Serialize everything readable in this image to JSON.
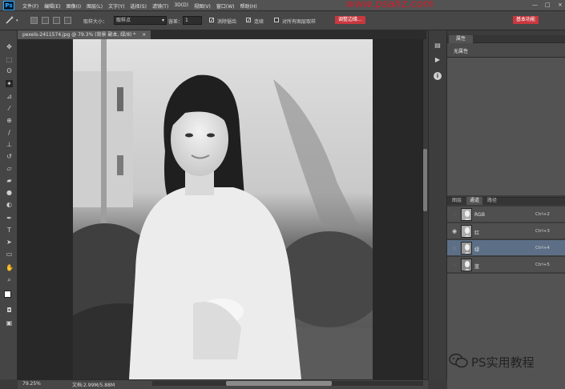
{
  "app": {
    "logo": "Ps"
  },
  "menu": [
    "文件(F)",
    "编辑(E)",
    "图像(I)",
    "图层(L)",
    "文字(Y)",
    "选择(S)",
    "滤镜(T)",
    "3D(D)",
    "视图(V)",
    "窗口(W)",
    "帮助(H)"
  ],
  "watermark": "www.psahz.com",
  "window_controls": [
    "—",
    "□",
    "×"
  ],
  "options": {
    "sample_size_label": "取样大小：",
    "sample_size_value": "取样点",
    "tolerance_label": "容差：",
    "tolerance_value": "1",
    "anti_alias_label": "消除锯齿",
    "anti_alias_checked": true,
    "contiguous_label": "连续",
    "contiguous_checked": true,
    "sample_all_label": "对所有图层取样",
    "sample_all_checked": false,
    "refine_edge_label": "调整边缘...",
    "workspace_label": "基本功能"
  },
  "document": {
    "tab_label": "pexels-2411574.jpg @ 79.3% (背景 副本, 绿/8) *",
    "close": "×"
  },
  "status": {
    "zoom": "79.25%",
    "doc_info": "文档:2.99M/5.88M"
  },
  "properties_panel": {
    "tab": "属性",
    "text": "无属性"
  },
  "channels_panel": {
    "tabs": [
      "图层",
      "通道",
      "路径"
    ],
    "rows": [
      {
        "name": "RGB",
        "shortcut": "Ctrl+2",
        "selected": false,
        "visible": false
      },
      {
        "name": "红",
        "shortcut": "Ctrl+3",
        "selected": false,
        "visible": true
      },
      {
        "name": "绿",
        "shortcut": "Ctrl+4",
        "selected": true,
        "visible": false
      },
      {
        "name": "蓝",
        "shortcut": "Ctrl+5",
        "selected": false,
        "visible": false
      }
    ]
  },
  "wechat_watermark": "PS实用教程",
  "icons": {
    "eye": "eye-icon",
    "magic_wand": "magic-wand-icon",
    "play": "play-icon",
    "info": "info-icon",
    "wechat": "wechat-icon"
  }
}
